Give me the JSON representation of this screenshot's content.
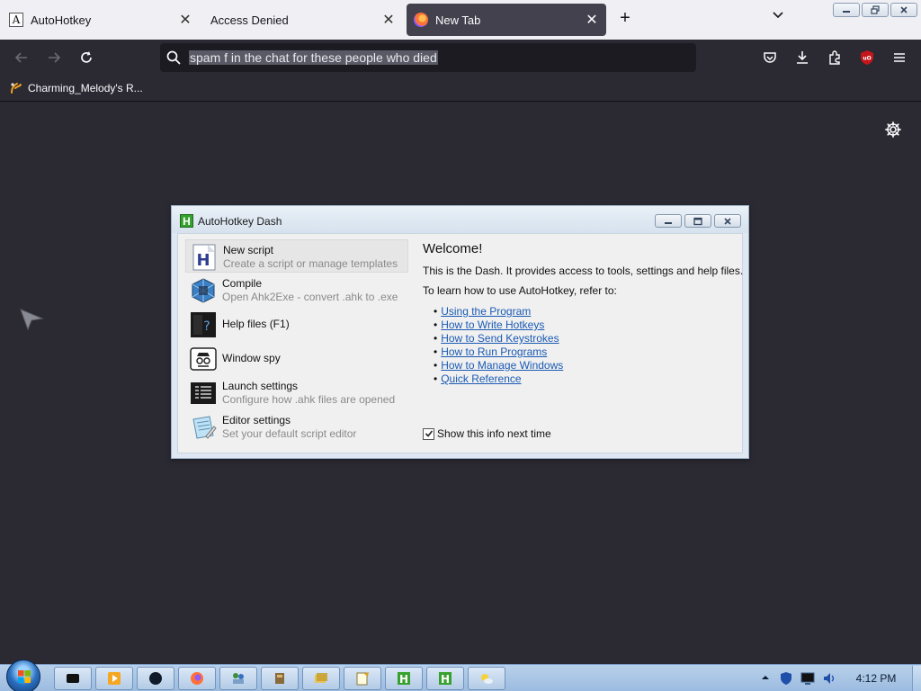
{
  "browser": {
    "tabs": [
      {
        "label": "AutoHotkey",
        "favicon": "a-letter-icon"
      },
      {
        "label": "Access Denied",
        "favicon": "none"
      },
      {
        "label": "New Tab",
        "favicon": "firefox-icon",
        "active": true
      }
    ],
    "urlbar": {
      "value": "spam f in the chat for these people who died"
    },
    "bookmarks": [
      {
        "label": "Charming_Melody's R...",
        "icon": "squiggle-icon"
      }
    ],
    "colors": {
      "chrome_dark": "#2b2a33",
      "tabstrip": "#f0f0f4",
      "urlbar_bg": "#1c1b22",
      "ublock_red": "#c4161c"
    }
  },
  "dash": {
    "title": "AutoHotkey Dash",
    "items": [
      {
        "title": "New script",
        "desc": "Create a script or manage templates",
        "icon": "new-script-icon"
      },
      {
        "title": "Compile",
        "desc": "Open Ahk2Exe - convert .ahk to .exe",
        "icon": "compile-icon"
      },
      {
        "title": "Help files (F1)",
        "desc": "",
        "icon": "help-files-icon"
      },
      {
        "title": "Window spy",
        "desc": "",
        "icon": "window-spy-icon"
      },
      {
        "title": "Launch settings",
        "desc": "Configure how .ahk files are opened",
        "icon": "launch-settings-icon"
      },
      {
        "title": "Editor settings",
        "desc": "Set your default script editor",
        "icon": "editor-settings-icon"
      }
    ],
    "welcome": {
      "heading": "Welcome!",
      "intro": "This is the Dash. It provides access to tools, settings and help files.",
      "learn": "To learn how to use AutoHotkey, refer to:",
      "links": [
        "Using the Program",
        "How to Write Hotkeys",
        "How to Send Keystrokes",
        "How to Run Programs",
        "How to Manage Windows",
        "Quick Reference"
      ],
      "bullet": "•",
      "show_info_label": "Show this info next time",
      "show_info_checked": true
    }
  },
  "taskbar": {
    "buttons": [
      "terminal-icon",
      "media-player-icon",
      "dark-circle-icon",
      "firefox-icon",
      "network-users-icon",
      "archive-icon",
      "folders-icon",
      "notepad-icon",
      "autohotkey-icon",
      "autohotkey-icon",
      "weather-icon"
    ],
    "time": "4:12 PM",
    "accent": "#9bbbe0"
  }
}
